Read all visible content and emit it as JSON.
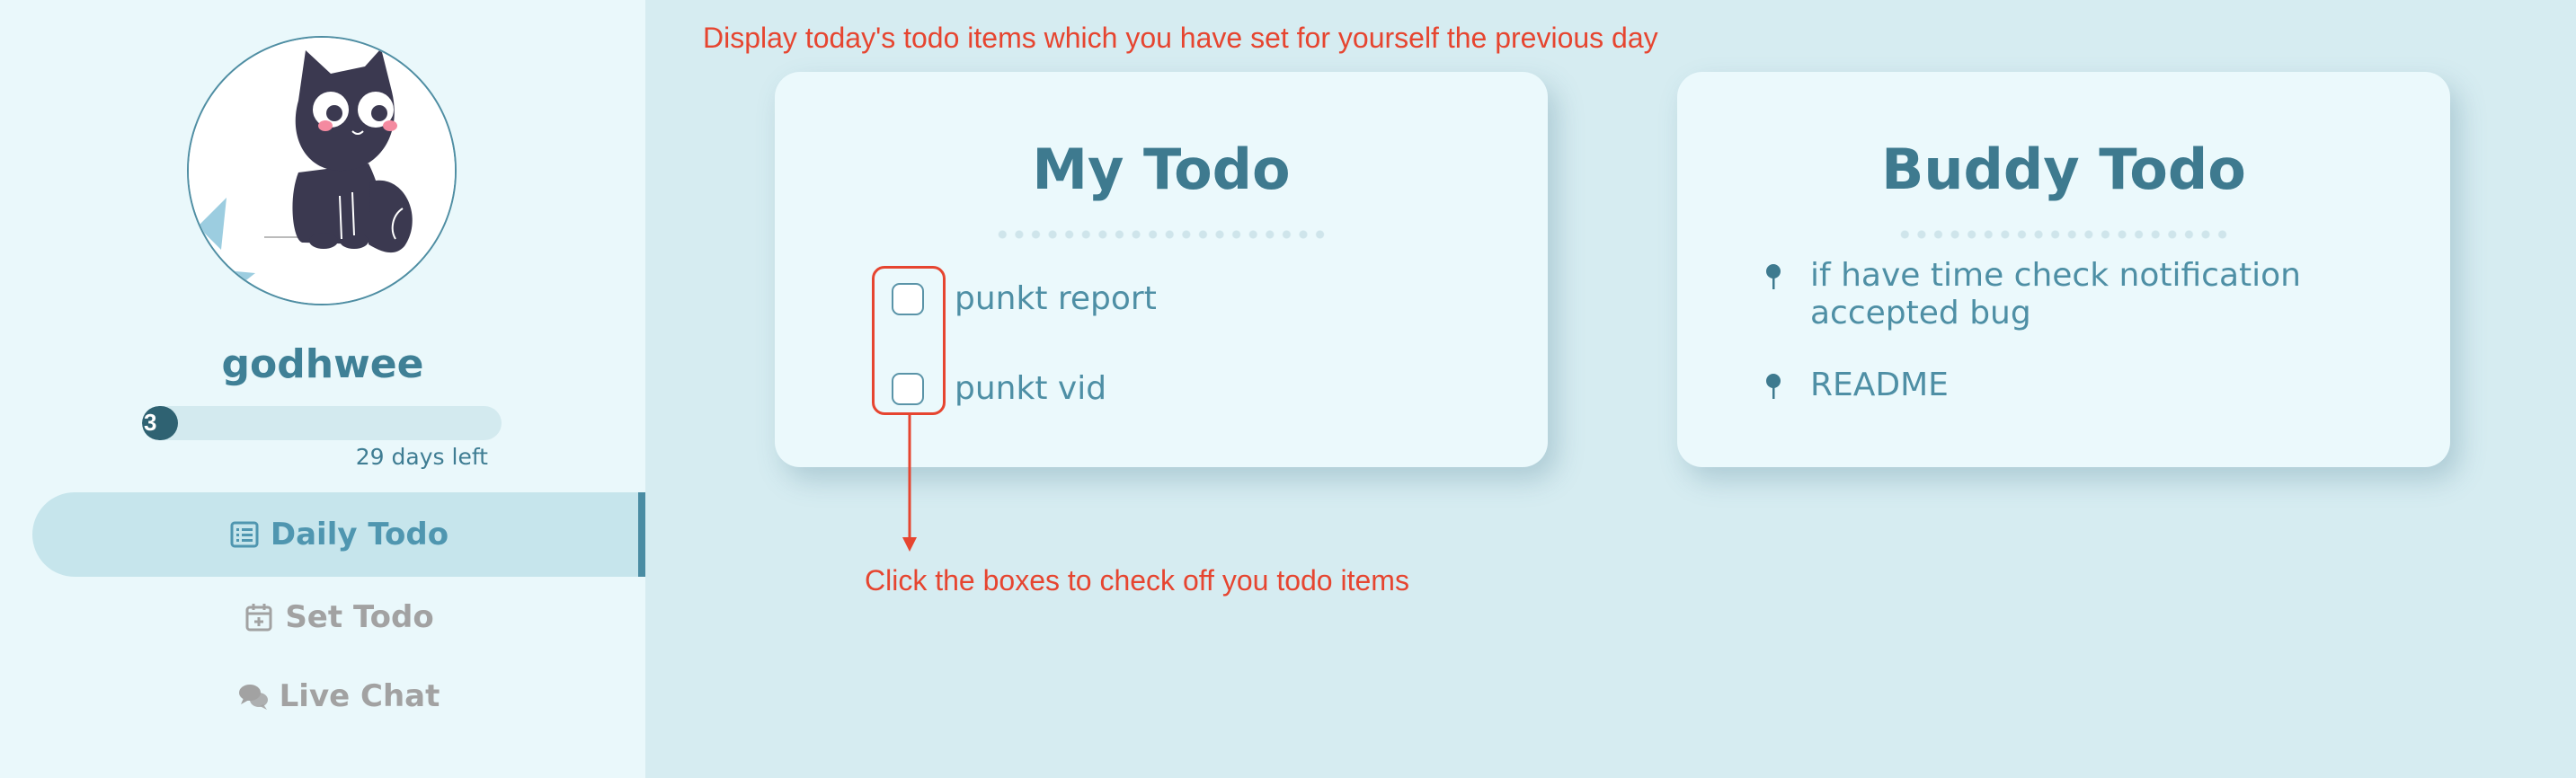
{
  "sidebar": {
    "username": "godhwee",
    "progress": {
      "value": "3",
      "fraction": 0.1,
      "days_left": "29 days left"
    },
    "nav": [
      {
        "label": "Daily Todo",
        "icon": "list-icon",
        "active": true
      },
      {
        "label": "Set Todo",
        "icon": "calendar-plus-icon",
        "active": false
      },
      {
        "label": "Live Chat",
        "icon": "comments-icon",
        "active": false
      }
    ]
  },
  "annotations": {
    "top": "Display today's todo items which you have set for yourself the previous day",
    "bottom": "Click the boxes to check off you todo items"
  },
  "my_todo": {
    "title": "My Todo",
    "items": [
      {
        "label": "punkt report",
        "checked": false
      },
      {
        "label": "punkt vid",
        "checked": false
      }
    ]
  },
  "buddy_todo": {
    "title": "Buddy Todo",
    "items": [
      {
        "label": "if have time check notification accepted bug",
        "icon": "pin-icon"
      },
      {
        "label": "README",
        "icon": "pin-icon"
      }
    ]
  },
  "colors": {
    "background": "#d6ecf1",
    "sidebar": "#eaf8fb",
    "accent": "#3e7a8f",
    "annotation": "#e64530",
    "inactive_nav": "#a2a2a2"
  }
}
